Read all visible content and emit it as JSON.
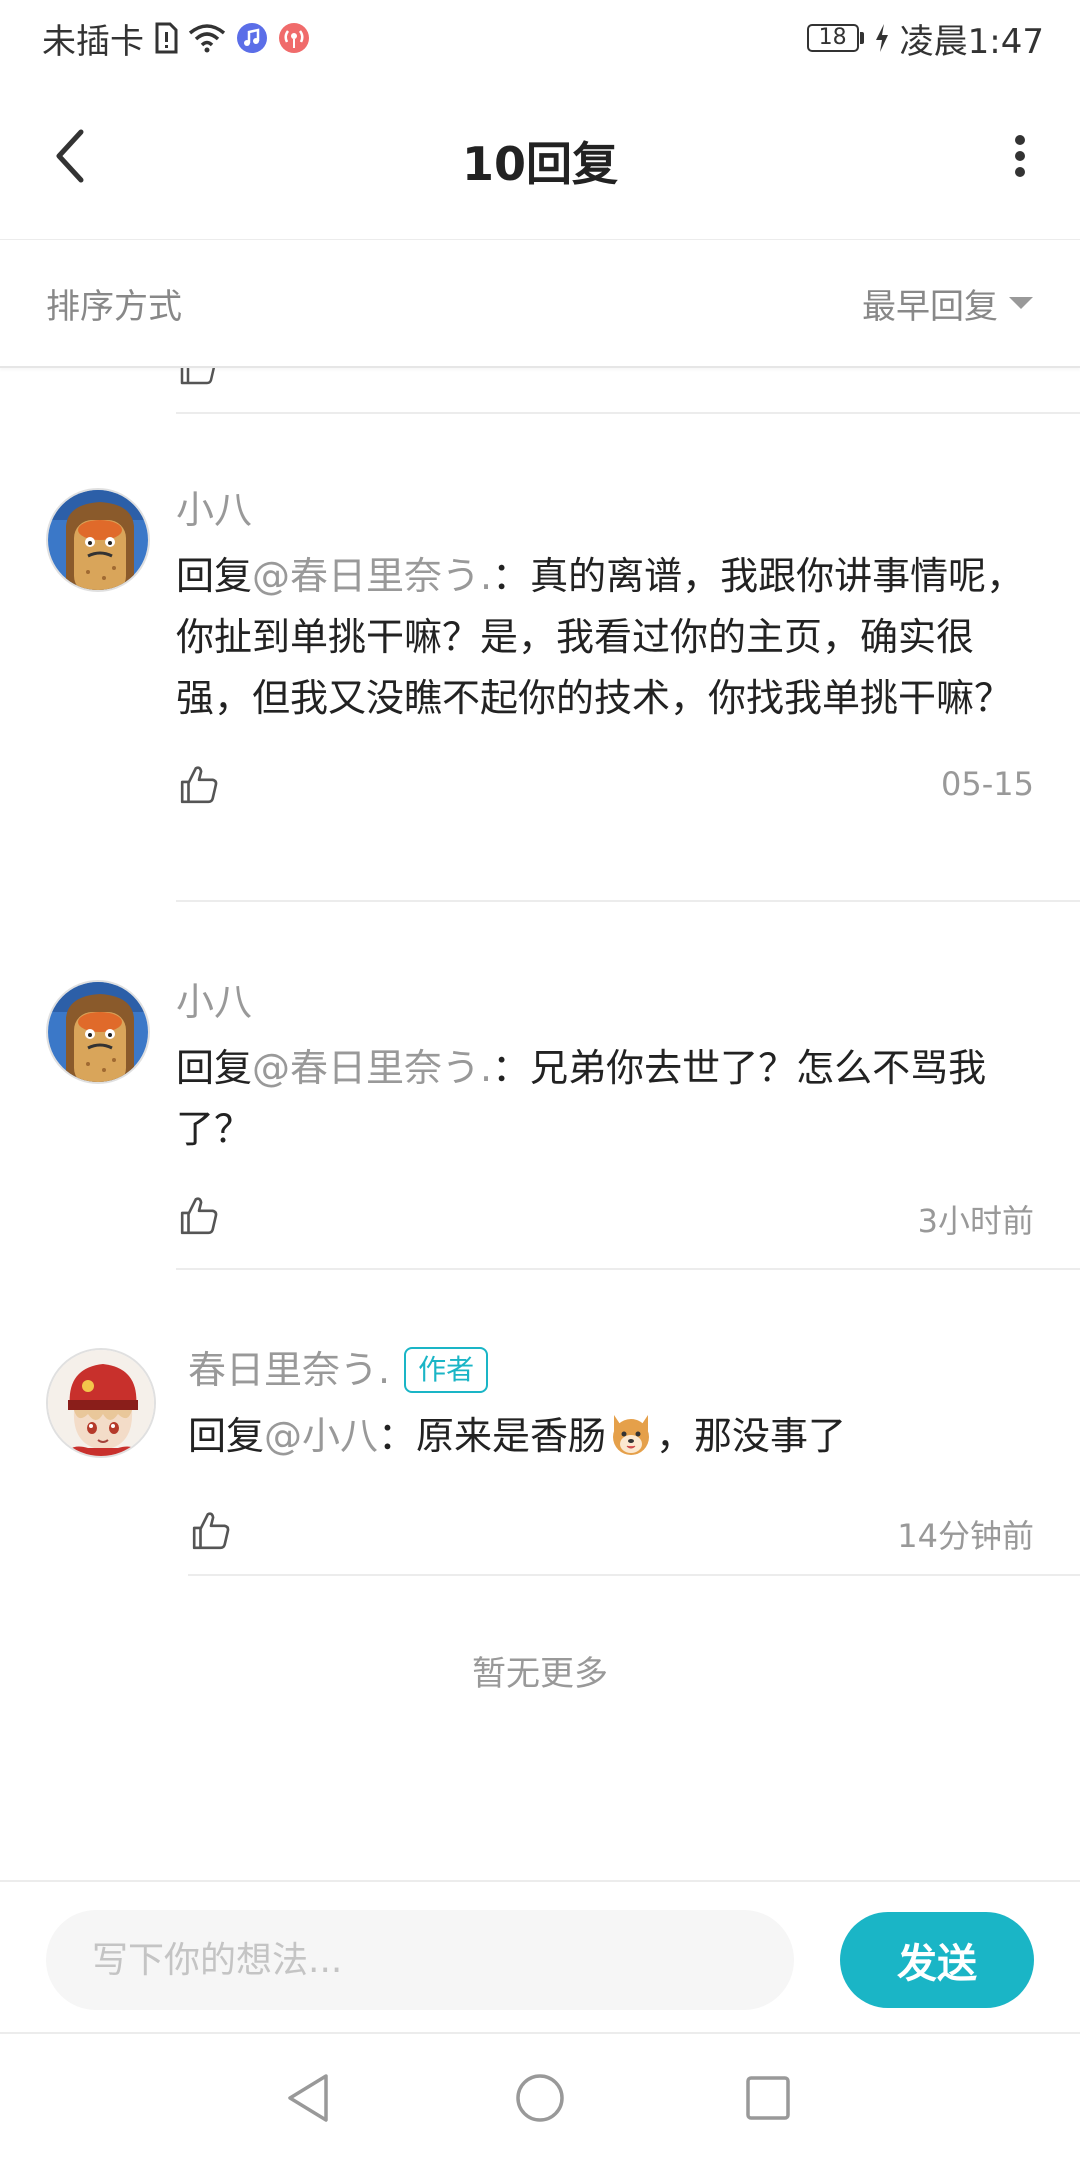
{
  "status_bar": {
    "carrier": "未插卡",
    "battery": "18",
    "time": "凌晨1:47",
    "icons": [
      "sim-icon",
      "wifi-icon",
      "music-icon",
      "podcast-icon",
      "charging-icon"
    ]
  },
  "header": {
    "title": "10回复",
    "back_icon": "chevron-left-icon",
    "more_icon": "more-vertical-icon"
  },
  "sort": {
    "label": "排序方式",
    "value": "最早回复",
    "dropdown_icon": "caret-down-icon"
  },
  "comments": [
    {
      "username": "小八",
      "reply_prefix": "回复",
      "mention": "@春日里奈う.",
      "text": "：真的离谱，我跟你讲事情呢，你扯到单挑干嘛？是，我看过你的主页，确实很强，但我又没瞧不起你的技术，你找我单挑干嘛？",
      "time": "05-15"
    },
    {
      "username": "小八",
      "reply_prefix": "回复",
      "mention": "@春日里奈う.",
      "text": "：兄弟你去世了？怎么不骂我了？",
      "time": "3小时前"
    },
    {
      "username": "春日里奈う.",
      "badge": "作者",
      "reply_prefix": "回复",
      "mention": "@小八",
      "text_before": "：原来是香肠",
      "emoji": "dog-face-emoji",
      "text_after": "，那没事了",
      "time": "14分钟前"
    }
  ],
  "no_more": "暂无更多",
  "input": {
    "placeholder": "写下你的想法...",
    "send_label": "发送"
  },
  "colors": {
    "accent": "#1ab5c6",
    "secondary_text": "#999999",
    "primary_text": "#222222"
  }
}
